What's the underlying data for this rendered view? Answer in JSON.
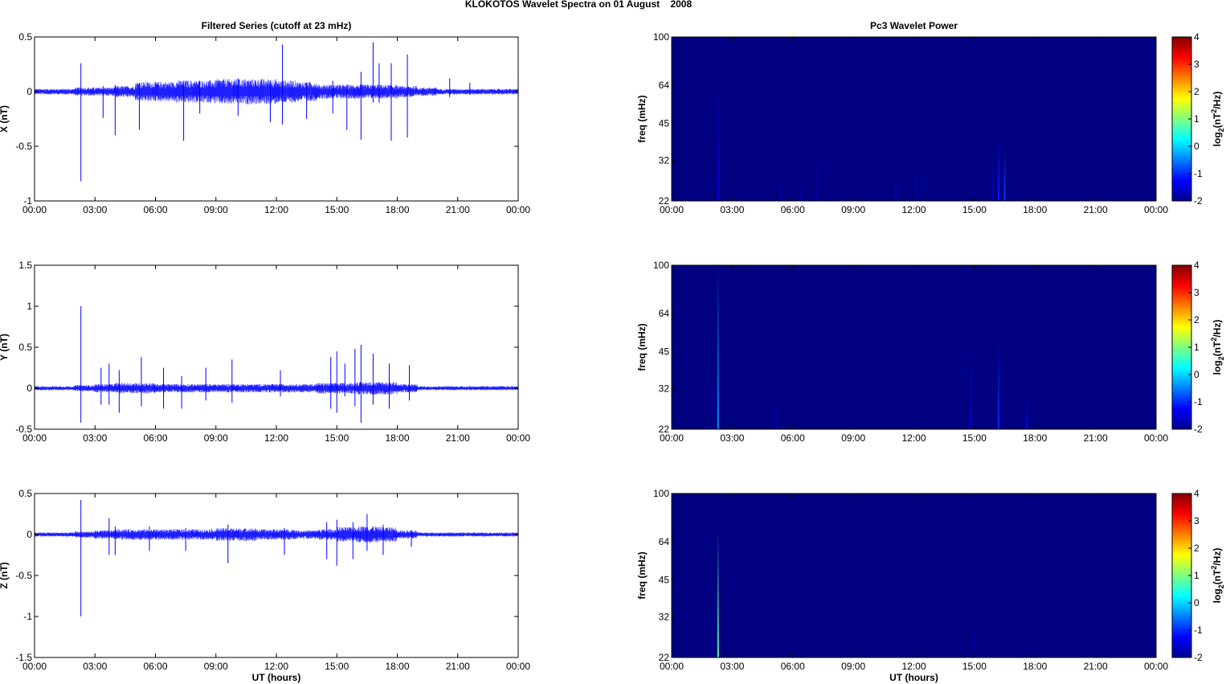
{
  "title": "KLOKOTOS Wavelet Spectra on 01 August    2008",
  "chart_data": [
    {
      "type": "line",
      "title": "Filtered Series (cutoff at 23 mHz)",
      "ylabel": "X (nT)",
      "xlabel": "",
      "xlim": [
        0,
        24
      ],
      "ylim": [
        -1,
        0.5
      ],
      "yticks": [
        "-1",
        "-0.5",
        "0",
        "0.5"
      ],
      "xticks": [
        "00:00",
        "03:00",
        "06:00",
        "09:00",
        "12:00",
        "15:00",
        "18:00",
        "21:00",
        "00:00"
      ],
      "color": "#0000ff",
      "envelope_hourly": [
        0.02,
        0.02,
        0.03,
        0.03,
        0.04,
        0.07,
        0.07,
        0.08,
        0.08,
        0.09,
        0.09,
        0.09,
        0.08,
        0.07,
        0.05,
        0.05,
        0.05,
        0.05,
        0.04,
        0.03,
        0.02,
        0.02,
        0.02,
        0.02
      ],
      "spikes": [
        [
          2.3,
          0.26,
          -0.82
        ],
        [
          3.4,
          0.05,
          -0.24
        ],
        [
          4,
          0.06,
          -0.4
        ],
        [
          5.2,
          0.08,
          -0.35
        ],
        [
          7.4,
          0.09,
          -0.45
        ],
        [
          8.2,
          0.1,
          -0.2
        ],
        [
          10.1,
          0.12,
          -0.22
        ],
        [
          11.7,
          0.1,
          -0.28
        ],
        [
          12.3,
          0.43,
          -0.3
        ],
        [
          13.5,
          0.08,
          -0.25
        ],
        [
          14.8,
          0.1,
          -0.2
        ],
        [
          15.5,
          0.05,
          -0.35
        ],
        [
          16.2,
          0.18,
          -0.44
        ],
        [
          16.8,
          0.45,
          -0.1
        ],
        [
          17.1,
          0.26,
          -0.1
        ],
        [
          17.7,
          0.26,
          -0.45
        ],
        [
          18.5,
          0.34,
          -0.42
        ],
        [
          20.6,
          0.12,
          -0.05
        ],
        [
          21.6,
          0.08,
          -0.03
        ]
      ]
    },
    {
      "type": "line",
      "title": "",
      "ylabel": "Y (nT)",
      "xlabel": "",
      "xlim": [
        0,
        24
      ],
      "ylim": [
        -0.5,
        1.5
      ],
      "yticks": [
        "-0.5",
        "0",
        "0.5",
        "1",
        "1.5"
      ],
      "xticks": [
        "00:00",
        "03:00",
        "06:00",
        "09:00",
        "12:00",
        "15:00",
        "18:00",
        "21:00",
        "00:00"
      ],
      "color": "#0000ff",
      "envelope_hourly": [
        0.02,
        0.02,
        0.03,
        0.04,
        0.05,
        0.05,
        0.04,
        0.04,
        0.04,
        0.04,
        0.04,
        0.04,
        0.04,
        0.04,
        0.05,
        0.05,
        0.06,
        0.06,
        0.04,
        0.02,
        0.02,
        0.02,
        0.02,
        0.02
      ],
      "spikes": [
        [
          2.3,
          1.0,
          -0.42
        ],
        [
          3.3,
          0.25,
          -0.2
        ],
        [
          3.7,
          0.3,
          -0.2
        ],
        [
          4.2,
          0.22,
          -0.3
        ],
        [
          5.3,
          0.38,
          -0.22
        ],
        [
          6.4,
          0.25,
          -0.25
        ],
        [
          7.3,
          0.15,
          -0.25
        ],
        [
          8.5,
          0.25,
          -0.15
        ],
        [
          9.8,
          0.35,
          -0.18
        ],
        [
          12.2,
          0.22,
          -0.1
        ],
        [
          14.7,
          0.38,
          -0.25
        ],
        [
          15,
          0.45,
          -0.3
        ],
        [
          15.4,
          0.3,
          -0.1
        ],
        [
          15.9,
          0.48,
          -0.22
        ],
        [
          16.2,
          0.53,
          -0.42
        ],
        [
          16.8,
          0.42,
          -0.2
        ],
        [
          17.6,
          0.3,
          -0.25
        ],
        [
          18.6,
          0.28,
          -0.15
        ]
      ]
    },
    {
      "type": "line",
      "title": "",
      "ylabel": "Z (nT)",
      "xlabel": "UT (hours)",
      "xlim": [
        0,
        24
      ],
      "ylim": [
        -1.5,
        0.5
      ],
      "yticks": [
        "-1.5",
        "-1",
        "-0.5",
        "0",
        "0.5"
      ],
      "xticks": [
        "00:00",
        "03:00",
        "06:00",
        "09:00",
        "12:00",
        "15:00",
        "18:00",
        "21:00",
        "00:00"
      ],
      "color": "#0000ff",
      "envelope_hourly": [
        0.02,
        0.02,
        0.03,
        0.04,
        0.05,
        0.05,
        0.05,
        0.05,
        0.05,
        0.06,
        0.06,
        0.05,
        0.05,
        0.04,
        0.05,
        0.07,
        0.08,
        0.07,
        0.04,
        0.02,
        0.02,
        0.02,
        0.02,
        0.02
      ],
      "spikes": [
        [
          2.3,
          0.42,
          -1.0
        ],
        [
          3.7,
          0.2,
          -0.25
        ],
        [
          4,
          0.1,
          -0.25
        ],
        [
          5.7,
          0.1,
          -0.2
        ],
        [
          7.5,
          0.08,
          -0.2
        ],
        [
          9.6,
          0.12,
          -0.35
        ],
        [
          12.4,
          0.08,
          -0.25
        ],
        [
          14.5,
          0.15,
          -0.3
        ],
        [
          15,
          0.18,
          -0.38
        ],
        [
          15.8,
          0.15,
          -0.3
        ],
        [
          16.5,
          0.25,
          -0.2
        ],
        [
          17.3,
          0.12,
          -0.25
        ],
        [
          18.7,
          0.05,
          -0.15
        ]
      ]
    },
    {
      "type": "heatmap",
      "title": "Pc3 Wavelet Power",
      "ylabel": "freq (mHz)",
      "xlabel": "",
      "xlim": [
        0,
        24
      ],
      "ylim": [
        22,
        100
      ],
      "yscale": "log",
      "yticks": [
        "22",
        "32",
        "45",
        "64",
        "100"
      ],
      "xticks": [
        "00:00",
        "03:00",
        "06:00",
        "09:00",
        "12:00",
        "15:00",
        "18:00",
        "21:00",
        "00:00"
      ],
      "background_value": -2,
      "streaks": [
        [
          2.3,
          80,
          -1.4
        ],
        [
          5.4,
          30,
          -1.7
        ],
        [
          6.4,
          26,
          -1.6
        ],
        [
          7.2,
          35,
          -1.7
        ],
        [
          11.1,
          28,
          -1.6
        ],
        [
          12.1,
          38,
          -1.7
        ],
        [
          16.2,
          42,
          -1.1
        ],
        [
          16.5,
          36,
          -0.9
        ],
        [
          15.9,
          38,
          -1.7
        ]
      ],
      "colorbar": {
        "label": "log2(nT2/Hz)",
        "ticks": [
          "-2",
          "-1",
          "0",
          "1",
          "2",
          "3",
          "4"
        ],
        "range": [
          -2,
          4
        ]
      }
    },
    {
      "type": "heatmap",
      "title": "",
      "ylabel": "freq (mHz)",
      "xlabel": "",
      "xlim": [
        0,
        24
      ],
      "ylim": [
        22,
        100
      ],
      "yscale": "log",
      "yticks": [
        "22",
        "32",
        "45",
        "64",
        "100"
      ],
      "xticks": [
        "00:00",
        "03:00",
        "06:00",
        "09:00",
        "12:00",
        "15:00",
        "18:00",
        "21:00",
        "00:00"
      ],
      "background_value": -2,
      "streaks": [
        [
          2.3,
          100,
          -0.4
        ],
        [
          5.2,
          32,
          -1.6
        ],
        [
          14.8,
          50,
          -1.5
        ],
        [
          16.2,
          50,
          -1.0
        ],
        [
          17.6,
          30,
          -1.3
        ]
      ],
      "colorbar": {
        "label": "log2(nT2/Hz)",
        "ticks": [
          "-2",
          "-1",
          "0",
          "1",
          "2",
          "3",
          "4"
        ],
        "range": [
          -2,
          4
        ]
      }
    },
    {
      "type": "heatmap",
      "title": "",
      "ylabel": "freq (mHz)",
      "xlabel": "UT (hours)",
      "xlim": [
        0,
        24
      ],
      "ylim": [
        22,
        100
      ],
      "yscale": "log",
      "yticks": [
        "22",
        "32",
        "45",
        "64",
        "100"
      ],
      "xticks": [
        "00:00",
        "03:00",
        "06:00",
        "09:00",
        "12:00",
        "15:00",
        "18:00",
        "21:00",
        "00:00"
      ],
      "background_value": -2,
      "streaks": [
        [
          2.3,
          70,
          0.8
        ],
        [
          15,
          30,
          -1.7
        ]
      ],
      "colorbar": {
        "label": "log2(nT2/Hz)",
        "ticks": [
          "-2",
          "-1",
          "0",
          "1",
          "2",
          "3",
          "4"
        ],
        "range": [
          -2,
          4
        ]
      }
    }
  ]
}
